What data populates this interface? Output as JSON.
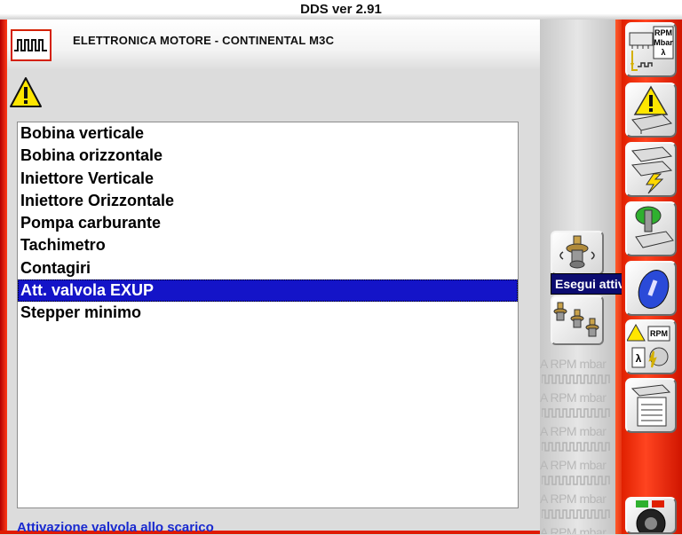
{
  "app": {
    "title": "DDS ver 2.91"
  },
  "header": {
    "title": "ELETTRONICA MOTORE - CONTINENTAL M3C"
  },
  "list": {
    "items": [
      "Bobina verticale",
      "Bobina orizzontale",
      "Iniettore Verticale",
      "Iniettore Orizzontale",
      "Pompa carburante",
      "Tachimetro",
      "Contagiri",
      "Att. valvola EXUP",
      "Stepper minimo"
    ],
    "selected_index": 7
  },
  "status": {
    "text": "Attivazione valvola allo scarico"
  },
  "tooltip": {
    "text": "Esegui attivazione"
  },
  "watermark": {
    "text": "A RPM mbar"
  },
  "sidebar": {
    "btn1": {
      "icon": "rpm-mbar-lambda-icon",
      "rpm": "RPM",
      "mbar": "Mbar",
      "lambda": "λ"
    },
    "btn6": {
      "icon": "rpm-lambda-warning-icon",
      "rpm": "RPM",
      "lambda": "λ"
    }
  },
  "colors": {
    "frame_red": "#e02000",
    "selection_blue": "#1414c8",
    "status_text": "#1a2acf",
    "tooltip_bg": "#0c0c70"
  }
}
